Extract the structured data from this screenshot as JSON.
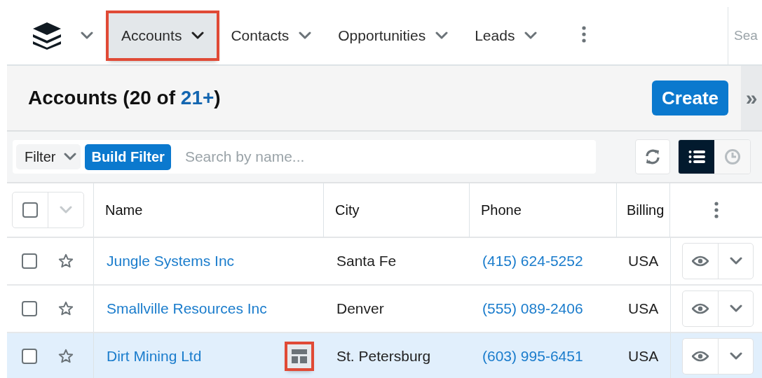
{
  "nav": {
    "tabs": [
      {
        "label": "Accounts",
        "selected": true,
        "annotated": true
      },
      {
        "label": "Contacts",
        "selected": false,
        "annotated": false
      },
      {
        "label": "Opportunities",
        "selected": false,
        "annotated": false
      },
      {
        "label": "Leads",
        "selected": false,
        "annotated": false
      }
    ],
    "search": {
      "placeholder": "Sea"
    }
  },
  "header": {
    "title": "Accounts (20 of ",
    "count": "21+",
    "title_end": ")",
    "create": "Create",
    "collapse": "»"
  },
  "filter_bar": {
    "filter": "Filter",
    "build_filter": "Build Filter",
    "search": {
      "placeholder": "Search by name..."
    },
    "list_view_selected": true
  },
  "table": {
    "select_all_checked": false,
    "columns": [
      "Name",
      "City",
      "Phone",
      "Billing"
    ],
    "rows": [
      {
        "name": "Jungle Systems Inc",
        "city": "Santa Fe",
        "phone": "(415) 624-5252",
        "billing": "USA",
        "checked": false,
        "favorite": false,
        "highlighted": false
      },
      {
        "name": "Smallville Resources Inc",
        "city": "Denver",
        "phone": "(555) 089-2406",
        "billing": "USA",
        "checked": false,
        "favorite": false,
        "highlighted": false
      },
      {
        "name": "Dirt Mining Ltd",
        "city": "St. Petersburg",
        "phone": "(603) 995-6451",
        "billing": "USA",
        "checked": false,
        "favorite": false,
        "highlighted": true
      }
    ]
  }
}
